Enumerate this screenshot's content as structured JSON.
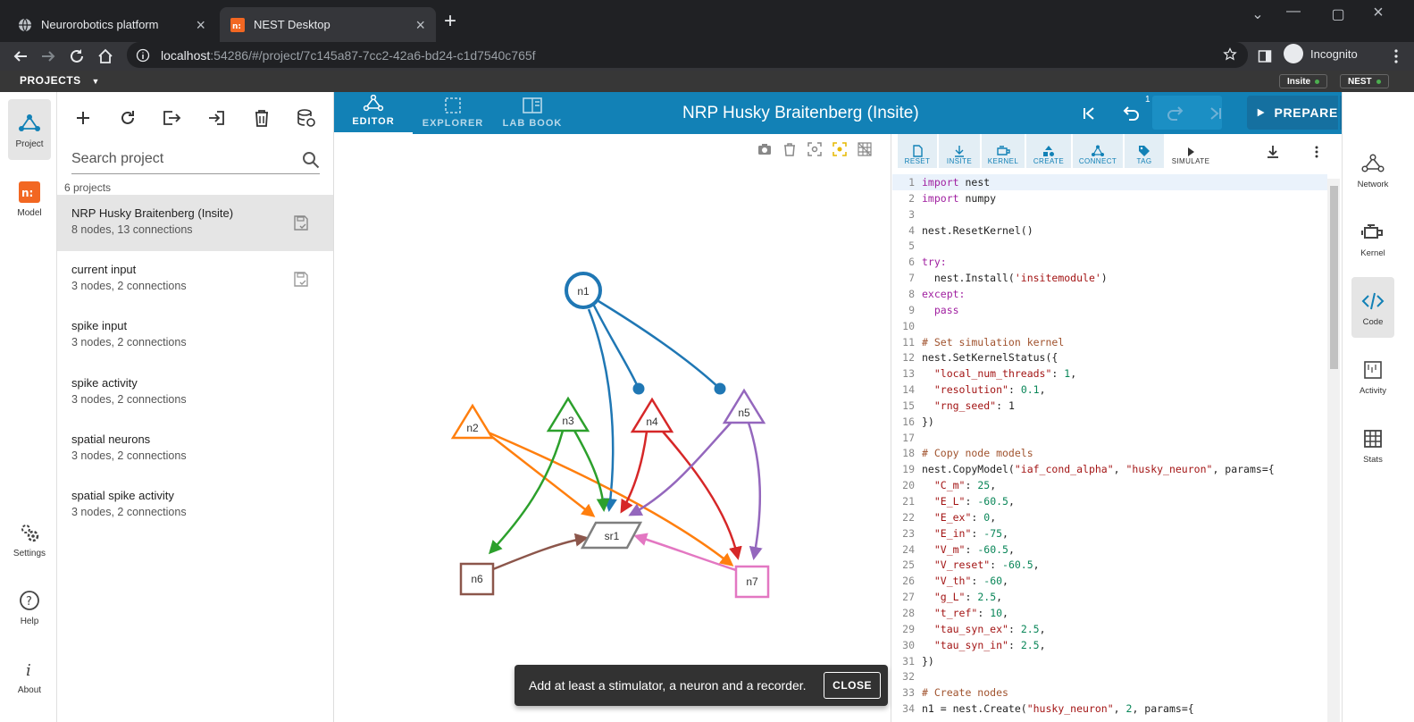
{
  "browser": {
    "tabs": [
      {
        "title": "Neurorobotics platform"
      },
      {
        "title": "NEST Desktop"
      }
    ],
    "address": {
      "host": "localhost",
      "path": ":54286/#/project/7c145a87-7cc2-42a6-bd24-c1d7540c765f"
    },
    "incognito_label": "Incognito"
  },
  "strip": {
    "projects_label": "PROJECTS",
    "pills": [
      {
        "label": "Insite",
        "color": "#4caf50"
      },
      {
        "label": "NEST",
        "color": "#4caf50"
      }
    ]
  },
  "left_nav": [
    {
      "label": "Project",
      "icon": "network-icon"
    },
    {
      "label": "Model",
      "icon": "model-icon"
    },
    {
      "label": "Settings",
      "icon": "gear-icon"
    },
    {
      "label": "Help",
      "icon": "help-icon"
    },
    {
      "label": "About",
      "icon": "info-icon"
    }
  ],
  "project_panel": {
    "search_placeholder": "Search project",
    "count_label": "6 projects",
    "projects": [
      {
        "name": "NRP Husky Braitenberg (Insite)",
        "desc": "8 nodes, 13 connections"
      },
      {
        "name": "current input",
        "desc": "3 nodes, 2 connections"
      },
      {
        "name": "spike input",
        "desc": "3 nodes, 2 connections"
      },
      {
        "name": "spike activity",
        "desc": "3 nodes, 2 connections"
      },
      {
        "name": "spatial neurons",
        "desc": "3 nodes, 2 connections"
      },
      {
        "name": "spatial spike activity",
        "desc": "3 nodes, 2 connections"
      }
    ]
  },
  "header": {
    "tabs": [
      {
        "label": "EDITOR"
      },
      {
        "label": "EXPLORER"
      },
      {
        "label": "LAB BOOK"
      }
    ],
    "title": "NRP Husky Braitenberg (Insite)",
    "undo_count": "1",
    "prepare_label": "PREPARE",
    "accent": "#1281b6"
  },
  "graph": {
    "nodes": [
      {
        "label": "n1",
        "color": "#1f77b4"
      },
      {
        "label": "n2",
        "color": "#ff7f0e"
      },
      {
        "label": "n3",
        "color": "#2ca02c"
      },
      {
        "label": "n4",
        "color": "#d62728"
      },
      {
        "label": "n5",
        "color": "#9467bd"
      },
      {
        "label": "n6",
        "color": "#8c564b"
      },
      {
        "label": "n7",
        "color": "#e377c2"
      },
      {
        "label": "sr1",
        "color": "#7f7f7f"
      }
    ]
  },
  "code_toolbar": [
    {
      "label": "RESET"
    },
    {
      "label": "INSITE"
    },
    {
      "label": "KERNEL"
    },
    {
      "label": "CREATE"
    },
    {
      "label": "CONNECT"
    },
    {
      "label": "TAG"
    },
    {
      "label": "SIMULATE"
    }
  ],
  "code_lines": [
    "import nest",
    "import numpy",
    "",
    "nest.ResetKernel()",
    "",
    "try:",
    "  nest.Install('insitemodule')",
    "except:",
    "  pass",
    "",
    "# Set simulation kernel",
    "nest.SetKernelStatus({",
    "  \"local_num_threads\": 1,",
    "  \"resolution\": 0.1,",
    "  \"rng_seed\": 1",
    "})",
    "",
    "# Copy node models",
    "nest.CopyModel(\"iaf_cond_alpha\", \"husky_neuron\", params={",
    "  \"C_m\": 25,",
    "  \"E_L\": -60.5,",
    "  \"E_ex\": 0,",
    "  \"E_in\": -75,",
    "  \"V_m\": -60.5,",
    "  \"V_reset\": -60.5,",
    "  \"V_th\": -60,",
    "  \"g_L\": 2.5,",
    "  \"t_ref\": 10,",
    "  \"tau_syn_ex\": 2.5,",
    "  \"tau_syn_in\": 2.5,",
    "})",
    "",
    "# Create nodes",
    "n1 = nest.Create(\"husky_neuron\", 2, params={"
  ],
  "right_nav": [
    {
      "label": "Network",
      "icon": "network-icon"
    },
    {
      "label": "Kernel",
      "icon": "engine-icon"
    },
    {
      "label": "Code",
      "icon": "code-icon"
    },
    {
      "label": "Activity",
      "icon": "activity-icon"
    },
    {
      "label": "Stats",
      "icon": "table-icon"
    }
  ],
  "snackbar": {
    "message": "Add at least a stimulator, a neuron and a recorder.",
    "close_label": "CLOSE"
  }
}
